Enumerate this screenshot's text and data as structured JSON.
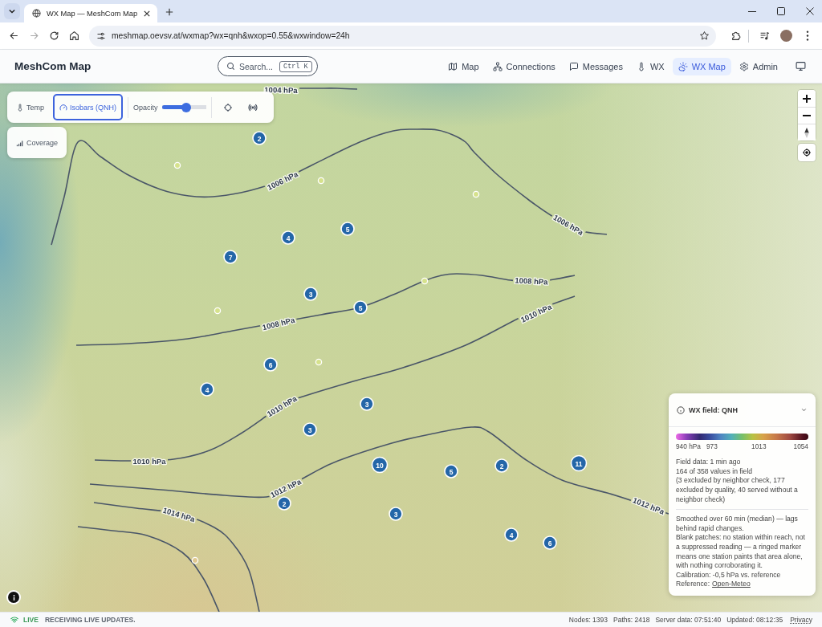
{
  "browser": {
    "tab": {
      "title": "WX Map — MeshCom Map"
    },
    "forward": {
      "disabled": true
    },
    "address": "meshmap.oevsv.at/wxmap?wx=qnh&wxop=0.55&wxwindow=24h"
  },
  "header": {
    "title": "MeshCom Map",
    "search": {
      "label": "Search...",
      "shortcut": "Ctrl K"
    },
    "nav": [
      {
        "label": "Map",
        "selected": false
      },
      {
        "label": "Connections",
        "selected": false
      },
      {
        "label": "Messages",
        "selected": false
      },
      {
        "label": "WX",
        "selected": false
      },
      {
        "label": "WX Map",
        "selected": true
      },
      {
        "label": "Admin",
        "selected": false
      }
    ]
  },
  "layer_toolbar": {
    "layers": [
      {
        "label": "Temp",
        "selected": false
      },
      {
        "label": "Isobars (QNH)",
        "selected": true
      }
    ],
    "opacity": {
      "label": "Opacity",
      "level": 0.55
    },
    "coverage": {
      "label": "Coverage",
      "selected": false
    }
  },
  "isobars": [
    {
      "labels": [
        "1004 hPa"
      ]
    },
    {
      "labels": [
        "1006 hPa",
        "1006 hPa"
      ]
    },
    {
      "labels": [
        "1008 hPa",
        "1008 hPa"
      ]
    },
    {
      "labels": [
        "1010 hPa",
        "1010 hPa",
        "1010 hPa"
      ]
    },
    {
      "labels": [
        "1012 hPa",
        "1012 hPa"
      ]
    },
    {
      "labels": [
        "1014 hPa"
      ]
    }
  ],
  "clusters": [
    {
      "count": "2"
    },
    {
      "count": "4"
    },
    {
      "count": "5"
    },
    {
      "count": "7"
    },
    {
      "count": "3"
    },
    {
      "count": "5"
    },
    {
      "count": "6"
    },
    {
      "count": "4"
    },
    {
      "count": "3"
    },
    {
      "count": "3"
    },
    {
      "count": "10"
    },
    {
      "count": "5"
    },
    {
      "count": "2"
    },
    {
      "count": "11"
    },
    {
      "count": "2"
    },
    {
      "count": "3"
    },
    {
      "count": "4"
    },
    {
      "count": "6"
    }
  ],
  "wx_legend": {
    "title": "WX field: QNH",
    "expanded": true,
    "scale_labels": [
      "940 hPa",
      "973",
      "1013",
      "1054"
    ],
    "field_info": [
      "Field data: 1 min ago",
      "164 of 358 values in field",
      "(3 excluded by neighbor check, 177 excluded by quality, 40 served without a neighbor check)"
    ],
    "notes": [
      "Smoothed over 60 min (median) — lags behind rapid changes.",
      "Blank patches: no station within reach, not a suppressed reading — a ringed marker means one station paints that area alone, with nothing corroborating it.",
      "Calibration: -0,5 hPa vs. reference"
    ],
    "reference": {
      "label": "Reference:",
      "link": "Open-Meteo"
    }
  },
  "status_bar": {
    "live": "LIVE",
    "message": "RECEIVING LIVE UPDATES.",
    "stats": [
      "Nodes: 1393",
      "Paths: 2418",
      "Server data: 07:51:40",
      "Updated: 08:12:35"
    ],
    "privacy": "Privacy"
  }
}
